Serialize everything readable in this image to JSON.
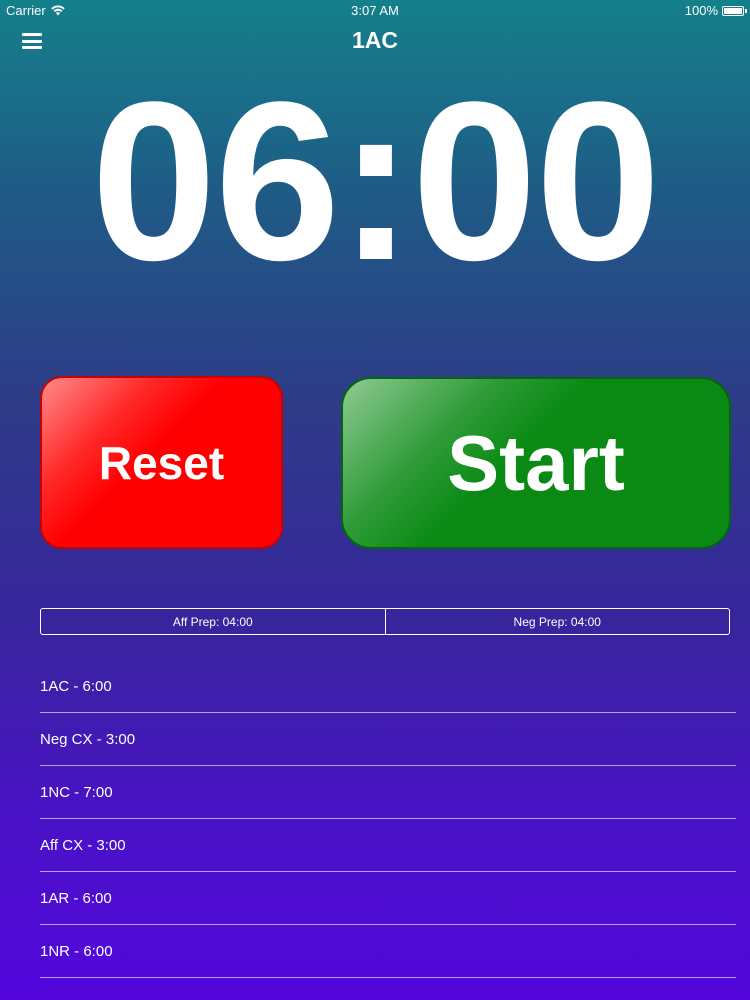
{
  "status_bar": {
    "carrier": "Carrier",
    "time": "3:07 AM",
    "battery": "100%",
    "battery_level": 1.0
  },
  "nav": {
    "title": "1AC",
    "menu_icon": "hamburger-menu-icon"
  },
  "timer": {
    "display": "06:00"
  },
  "buttons": {
    "reset_label": "Reset",
    "start_label": "Start",
    "reset_color": "#ff0000",
    "start_color": "#0a8a14"
  },
  "prep": {
    "aff": "Aff Prep: 04:00",
    "neg": "Neg Prep: 04:00"
  },
  "speeches": [
    "1AC - 6:00",
    "Neg CX - 3:00",
    "1NC - 7:00",
    "Aff CX - 3:00",
    "1AR - 6:00",
    "1NR - 6:00"
  ]
}
